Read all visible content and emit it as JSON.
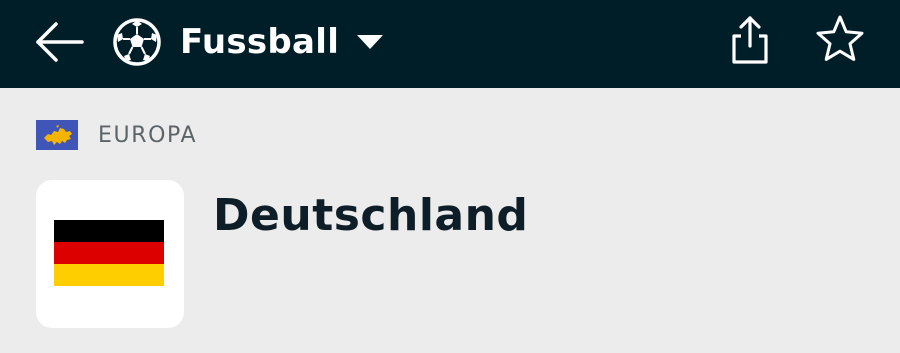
{
  "header": {
    "back_icon": "arrow-left-icon",
    "sport_icon": "soccer-ball-icon",
    "sport_label": "Fussball",
    "dropdown_icon": "caret-down-icon",
    "share_icon": "share-icon",
    "favorite_icon": "star-outline-icon",
    "background_color": "#001e28"
  },
  "region": {
    "flag_icon": "europe-flag-icon",
    "label": "EUROPA"
  },
  "country": {
    "name": "Deutschland",
    "flag_icon": "germany-flag-icon",
    "flag_colors": [
      "#000000",
      "#dd0000",
      "#ffce00"
    ]
  }
}
